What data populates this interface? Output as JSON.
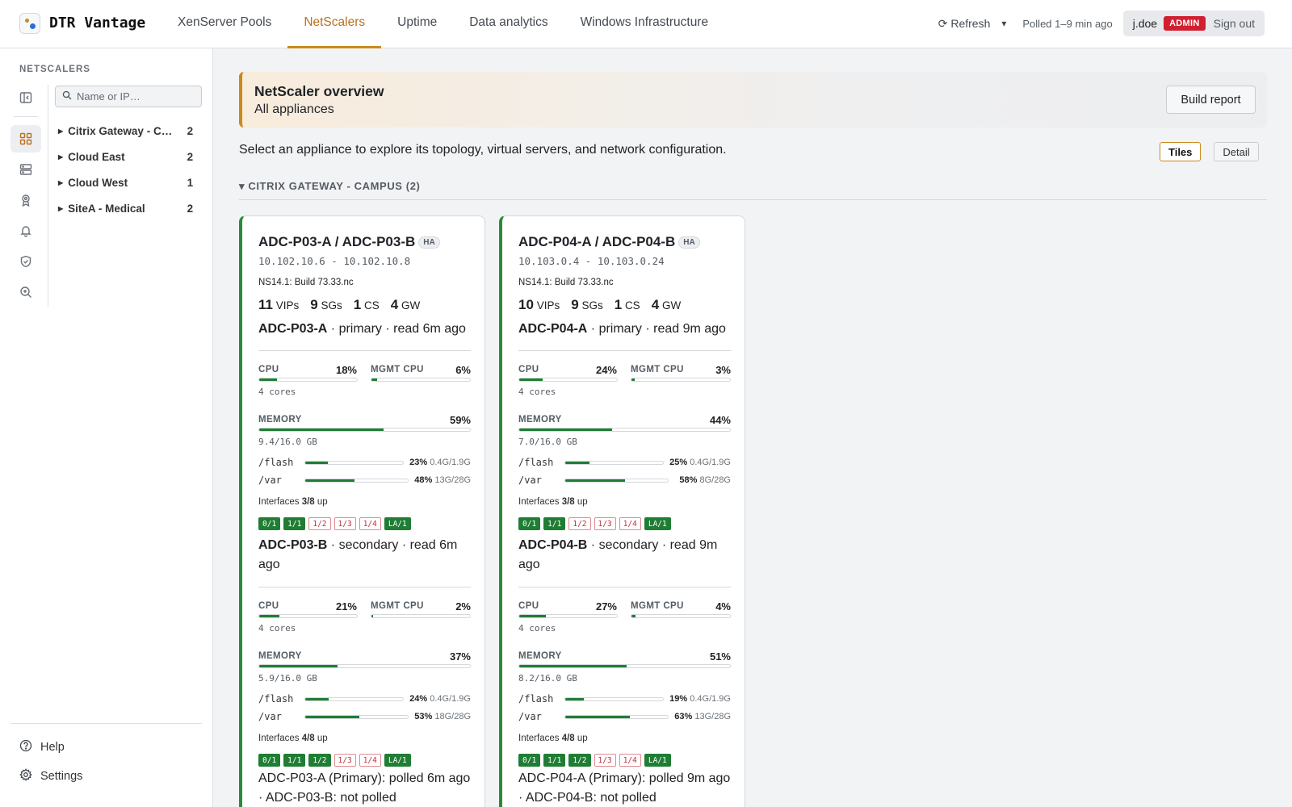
{
  "app": {
    "name": "DTR Vantage"
  },
  "nav": [
    {
      "label": "XenServer Pools",
      "active": false
    },
    {
      "label": "NetScalers",
      "active": true
    },
    {
      "label": "Uptime",
      "active": false
    },
    {
      "label": "Data analytics",
      "active": false
    },
    {
      "label": "Windows Infrastructure",
      "active": false
    }
  ],
  "topright": {
    "refresh": "⟳ Refresh",
    "caret": "▾",
    "polled": "Polled 1–9 min ago",
    "user": "j.doe",
    "role": "ADMIN",
    "signout": "Sign out"
  },
  "sidebar": {
    "heading": "NETSCALERS",
    "search_placeholder": "Name or IP…",
    "tree": [
      {
        "label": "Citrix Gateway - Campus",
        "count": "2"
      },
      {
        "label": "Cloud East",
        "count": "2"
      },
      {
        "label": "Cloud West",
        "count": "1"
      },
      {
        "label": "SiteA - Medical",
        "count": "2"
      }
    ],
    "rail_icons": [
      "collapse-sidebar-icon",
      "grid-icon",
      "server-icon",
      "award-icon",
      "bell-icon",
      "shield-check-icon",
      "zoom-in-icon"
    ],
    "help": "Help",
    "settings": "Settings"
  },
  "banner": {
    "title": "NetScaler overview",
    "subtitle": "All appliances",
    "button": "Build report"
  },
  "intro": "Select an appliance to explore its topology, virtual servers, and network configuration.",
  "view_toggle": {
    "tiles": "Tiles",
    "detail": "Detail",
    "active": "tiles"
  },
  "group": {
    "label": "▾ CITRIX GATEWAY - CAMPUS (2)"
  },
  "colors": {
    "accent": "#c98a1b",
    "healthy": "#2a8a3a",
    "bar": "#1f7d34",
    "admin": "#d0202f"
  },
  "cards": [
    {
      "title": "ADC-P03-A / ADC-P03-B",
      "badge": "HA",
      "ips": "10.102.10.6 - 10.102.10.8",
      "build": "NS14.1: Build 73.33.nc",
      "stats": [
        {
          "n": "11",
          "l": "VIPs"
        },
        {
          "n": "9",
          "l": "SGs"
        },
        {
          "n": "1",
          "l": "CS"
        },
        {
          "n": "4",
          "l": "GW"
        }
      ],
      "nodes": [
        {
          "name": "ADC-P03-A",
          "meta": " · primary · read 6m ago",
          "cpu": "18%",
          "cpu_pct": 18,
          "cores": "4 cores",
          "mgmt": "6%",
          "mgmt_pct": 6,
          "mem": "59%",
          "mem_pct": 59,
          "mem_sub": "9.4/16.0 GB",
          "disks": [
            {
              "name": "/flash",
              "pct": "23%",
              "pct_n": 23,
              "size": "0.4G/1.9G"
            },
            {
              "name": "/var",
              "pct": "48%",
              "pct_n": 48,
              "size": "13G/28G"
            }
          ],
          "ifaces_up": "3/8",
          "chips": [
            {
              "l": "0/1",
              "up": true
            },
            {
              "l": "1/1",
              "up": true
            },
            {
              "l": "1/2",
              "up": false
            },
            {
              "l": "1/3",
              "up": false
            },
            {
              "l": "1/4",
              "up": false
            },
            {
              "l": "LA/1",
              "up": true
            }
          ]
        },
        {
          "name": "ADC-P03-B",
          "meta": " · secondary · read 6m ago",
          "cpu": "21%",
          "cpu_pct": 21,
          "cores": "4 cores",
          "mgmt": "2%",
          "mgmt_pct": 2,
          "mem": "37%",
          "mem_pct": 37,
          "mem_sub": "5.9/16.0 GB",
          "disks": [
            {
              "name": "/flash",
              "pct": "24%",
              "pct_n": 24,
              "size": "0.4G/1.9G"
            },
            {
              "name": "/var",
              "pct": "53%",
              "pct_n": 53,
              "size": "18G/28G"
            }
          ],
          "ifaces_up": "4/8",
          "chips": [
            {
              "l": "0/1",
              "up": true
            },
            {
              "l": "1/1",
              "up": true
            },
            {
              "l": "1/2",
              "up": true
            },
            {
              "l": "1/3",
              "up": false
            },
            {
              "l": "1/4",
              "up": false
            },
            {
              "l": "LA/1",
              "up": true
            }
          ]
        }
      ],
      "footer": "ADC-P03-A (Primary): polled 6m ago · ADC-P03-B: not polled"
    },
    {
      "title": "ADC-P04-A / ADC-P04-B",
      "badge": "HA",
      "ips": "10.103.0.4 - 10.103.0.24",
      "build": "NS14.1: Build 73.33.nc",
      "stats": [
        {
          "n": "10",
          "l": "VIPs"
        },
        {
          "n": "9",
          "l": "SGs"
        },
        {
          "n": "1",
          "l": "CS"
        },
        {
          "n": "4",
          "l": "GW"
        }
      ],
      "nodes": [
        {
          "name": "ADC-P04-A",
          "meta": " · primary · read 9m ago",
          "cpu": "24%",
          "cpu_pct": 24,
          "cores": "4 cores",
          "mgmt": "3%",
          "mgmt_pct": 3,
          "mem": "44%",
          "mem_pct": 44,
          "mem_sub": "7.0/16.0 GB",
          "disks": [
            {
              "name": "/flash",
              "pct": "25%",
              "pct_n": 25,
              "size": "0.4G/1.9G"
            },
            {
              "name": "/var",
              "pct": "58%",
              "pct_n": 58,
              "size": "8G/28G"
            }
          ],
          "ifaces_up": "3/8",
          "chips": [
            {
              "l": "0/1",
              "up": true
            },
            {
              "l": "1/1",
              "up": true
            },
            {
              "l": "1/2",
              "up": false
            },
            {
              "l": "1/3",
              "up": false
            },
            {
              "l": "1/4",
              "up": false
            },
            {
              "l": "LA/1",
              "up": true
            }
          ]
        },
        {
          "name": "ADC-P04-B",
          "meta": " · secondary · read 9m ago",
          "cpu": "27%",
          "cpu_pct": 27,
          "cores": "4 cores",
          "mgmt": "4%",
          "mgmt_pct": 4,
          "mem": "51%",
          "mem_pct": 51,
          "mem_sub": "8.2/16.0 GB",
          "disks": [
            {
              "name": "/flash",
              "pct": "19%",
              "pct_n": 19,
              "size": "0.4G/1.9G"
            },
            {
              "name": "/var",
              "pct": "63%",
              "pct_n": 63,
              "size": "13G/28G"
            }
          ],
          "ifaces_up": "4/8",
          "chips": [
            {
              "l": "0/1",
              "up": true
            },
            {
              "l": "1/1",
              "up": true
            },
            {
              "l": "1/2",
              "up": true
            },
            {
              "l": "1/3",
              "up": false
            },
            {
              "l": "1/4",
              "up": false
            },
            {
              "l": "LA/1",
              "up": true
            }
          ]
        }
      ],
      "footer": "ADC-P04-A (Primary): polled 9m ago · ADC-P04-B: not polled"
    }
  ]
}
